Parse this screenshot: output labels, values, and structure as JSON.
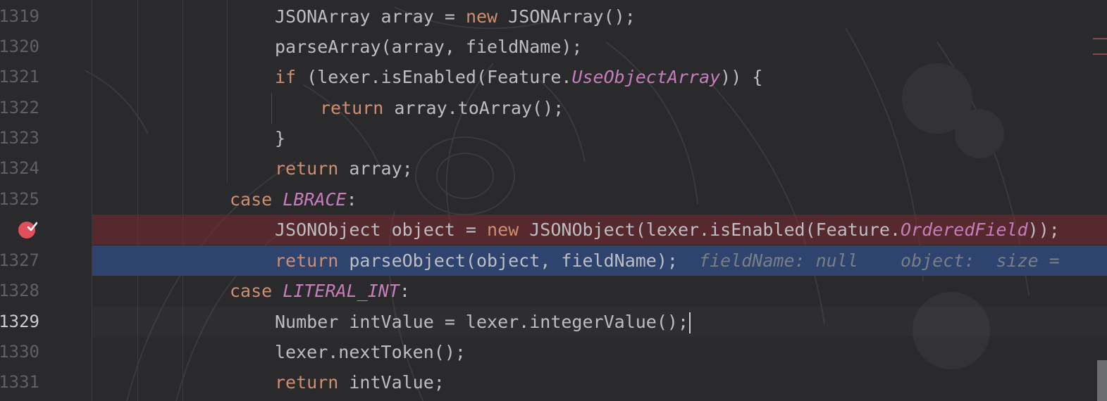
{
  "colors": {
    "background": "#2a2a2d",
    "keyword": "#cf8e6d",
    "static_field": "#c77dbb",
    "default_text": "#bcbec4",
    "breakpoint_line": "#5b2c34",
    "execution_line": "#2e436e",
    "line_number": "#5f6166",
    "breakpoint_icon": "#e0505a"
  },
  "icons": {
    "breakpoint": "breakpoint-verified-icon"
  },
  "gutter": {
    "line_numbers": [
      "1319",
      "1320",
      "1321",
      "1322",
      "1323",
      "1324",
      "1325",
      "",
      "1327",
      "1328",
      "1329",
      "1330",
      "1331"
    ],
    "current_line": "1329"
  },
  "code": {
    "l1319": {
      "a": "JSONArray array = ",
      "b": "new",
      "c": " JSONArray();"
    },
    "l1320": {
      "a": "parseArray(array, fieldName);"
    },
    "l1321": {
      "a": "if",
      "b": " (lexer.isEnabled(Feature.",
      "c": "UseObjectArray",
      "d": ")) {"
    },
    "l1322": {
      "a": "return",
      "b": " array.toArray();"
    },
    "l1323": {
      "a": "}"
    },
    "l1324": {
      "a": "return",
      "b": " array;"
    },
    "l1325": {
      "a": "case",
      "b": " ",
      "c": "LBRACE",
      "d": ":"
    },
    "l1326": {
      "a": "JSONObject object = ",
      "b": "new",
      "c": " JSONObject(lexer.isEnabled(Feature.",
      "d": "OrderedField",
      "e": "));"
    },
    "l1327": {
      "a": "return",
      "b": " parseObject(object, fieldName);",
      "hint": "  fieldName: null    object:  size ="
    },
    "l1328": {
      "a": "case",
      "b": " ",
      "c": "LITERAL_INT",
      "d": ":"
    },
    "l1329": {
      "a": "Number intValue = lexer.integerValue();"
    },
    "l1330": {
      "a": "lexer.nextToken();"
    },
    "l1331": {
      "a": "return",
      "b": " intValue;"
    }
  }
}
